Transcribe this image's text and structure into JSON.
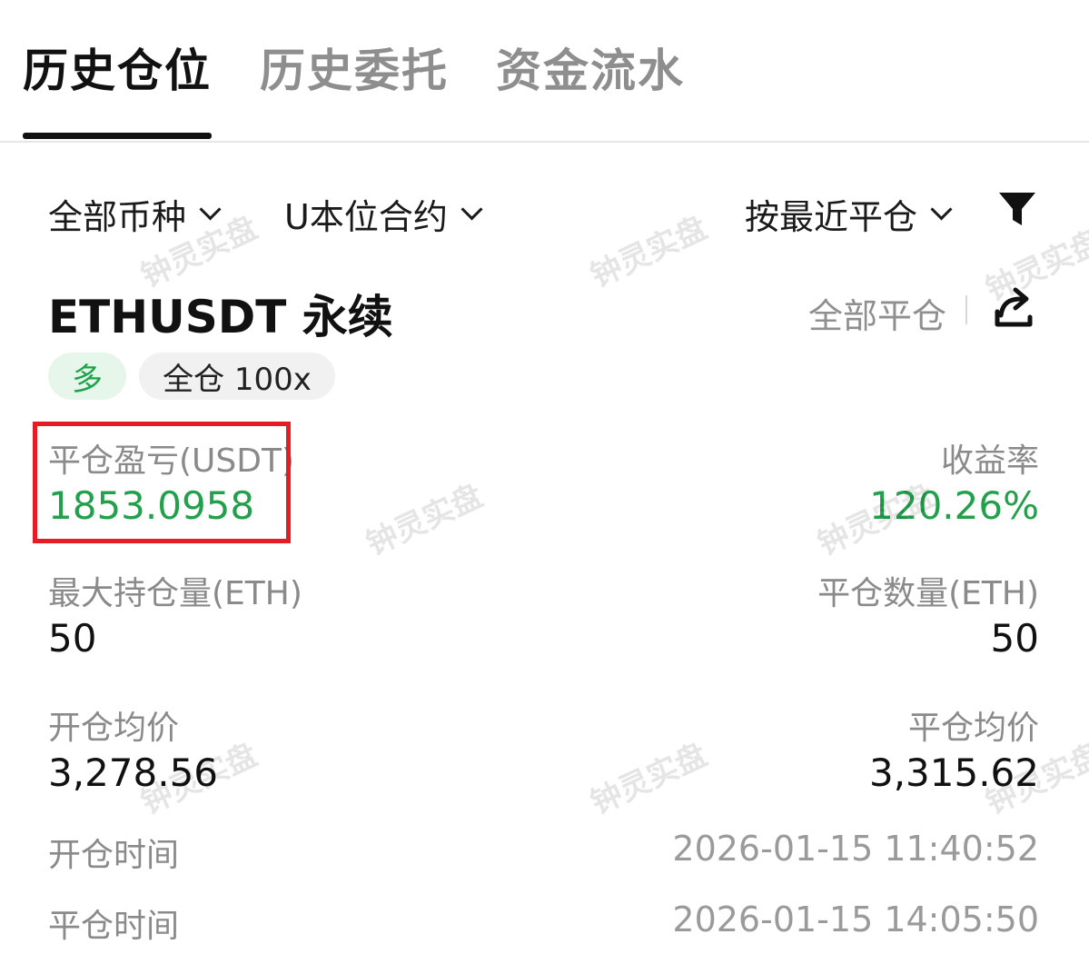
{
  "tabs": [
    {
      "label": "历史仓位",
      "active": true
    },
    {
      "label": "历史委托",
      "active": false
    },
    {
      "label": "资金流水",
      "active": false
    }
  ],
  "filters": {
    "coin": "全部币种",
    "contract": "U本位合约",
    "sort": "按最近平仓",
    "filter_icon": "funnel-icon"
  },
  "position": {
    "symbol": "ETHUSDT 永续",
    "close_all_label": "全部平仓",
    "share_icon": "share-icon",
    "side_badge": "多",
    "margin_badge": "全仓 100x",
    "pnl_label": "平仓盈亏(USDT)",
    "pnl_value": "1853.0958",
    "roi_label": "收益率",
    "roi_value": "120.26%",
    "max_pos_label": "最大持仓量(ETH)",
    "max_pos_value": "50",
    "close_qty_label": "平仓数量(ETH)",
    "close_qty_value": "50",
    "open_price_label": "开仓均价",
    "open_price_value": "3,278.56",
    "close_price_label": "平仓均价",
    "close_price_value": "3,315.62",
    "open_time_label": "开仓时间",
    "open_time_value": "2026-01-15 11:40:52",
    "close_time_label": "平仓时间",
    "close_time_value": "2026-01-15 14:05:50"
  },
  "watermark": "钟灵实盘",
  "colors": {
    "profit_green": "#22a04b",
    "highlight_red": "#e51c23"
  }
}
